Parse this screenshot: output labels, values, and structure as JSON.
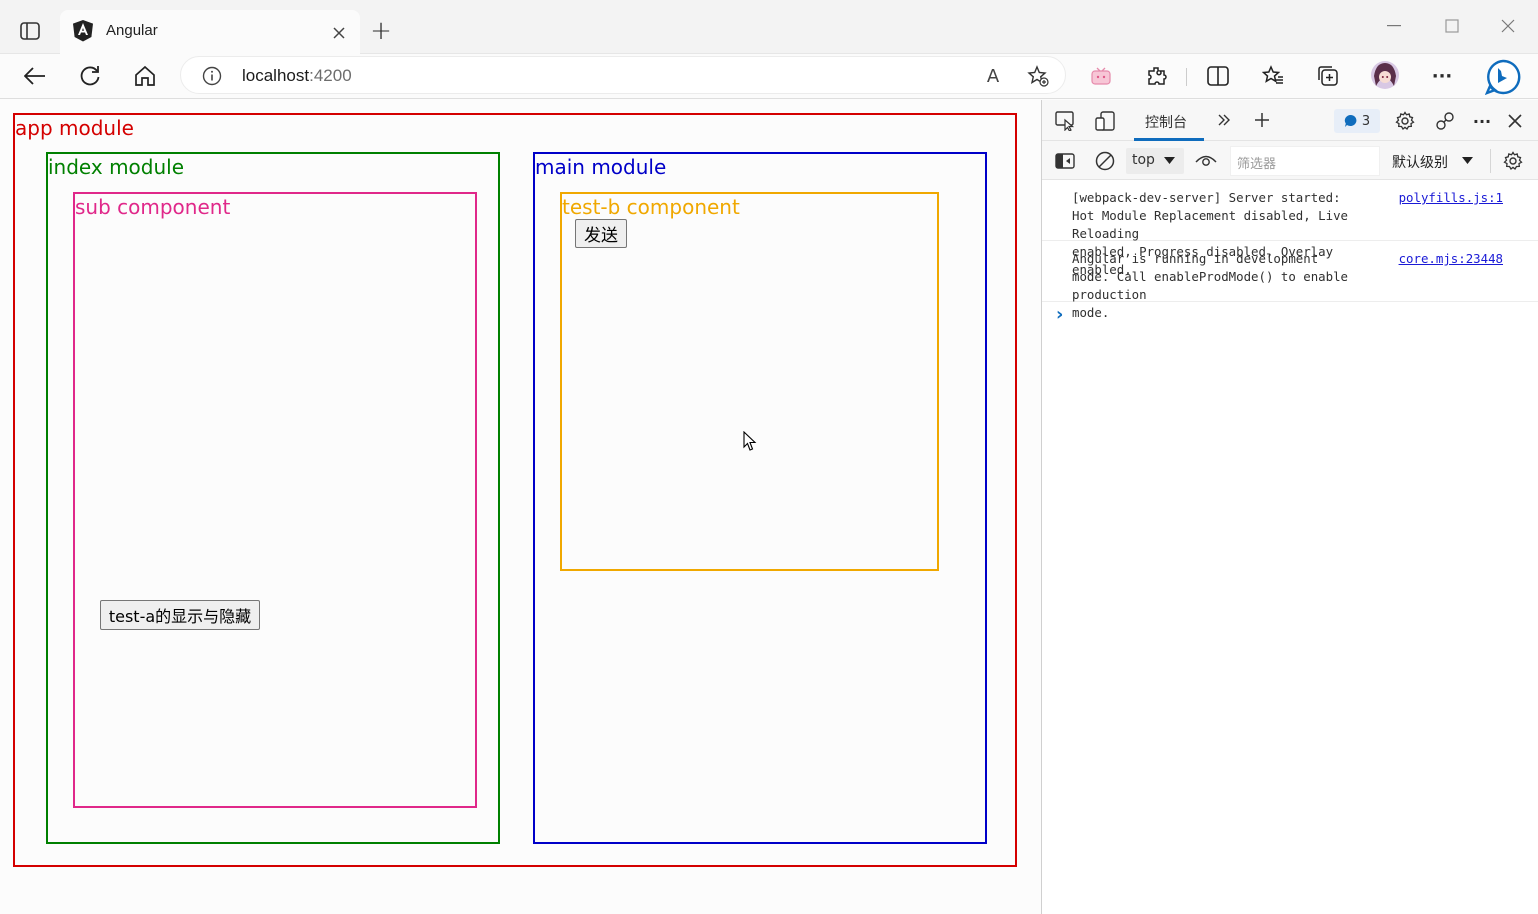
{
  "browser": {
    "tab_title": "Angular",
    "new_tab": "+",
    "url_host": "localhost",
    "url_port": ":4200",
    "read_aloud": "A",
    "more": "···"
  },
  "page": {
    "app_module": "app module",
    "index_module": "index module",
    "sub_component": "sub component",
    "toggle_button": "test-a的显示与隐藏",
    "main_module": "main module",
    "test_b_component": "test-b component",
    "send_button": "发送"
  },
  "devtools": {
    "tab_console": "控制台",
    "issues_count": "3",
    "context": "top",
    "filter_placeholder": "筛选器",
    "level": "默认级别",
    "messages": [
      {
        "text": "[webpack-dev-server] Server started:\nHot Module Replacement disabled, Live Reloading\nenabled, Progress disabled, Overlay enabled.",
        "source": "polyfills.js:1"
      },
      {
        "text": "Angular is running in development\nmode. Call enableProdMode() to enable production\nmode.",
        "source": "core.mjs:23448"
      }
    ],
    "prompt": "›"
  },
  "colors": {
    "app": "#d40000",
    "index": "#008000",
    "sub": "#e0288a",
    "main": "#0000c8",
    "test_b": "#f0a800",
    "accent": "#0f6cbd"
  }
}
